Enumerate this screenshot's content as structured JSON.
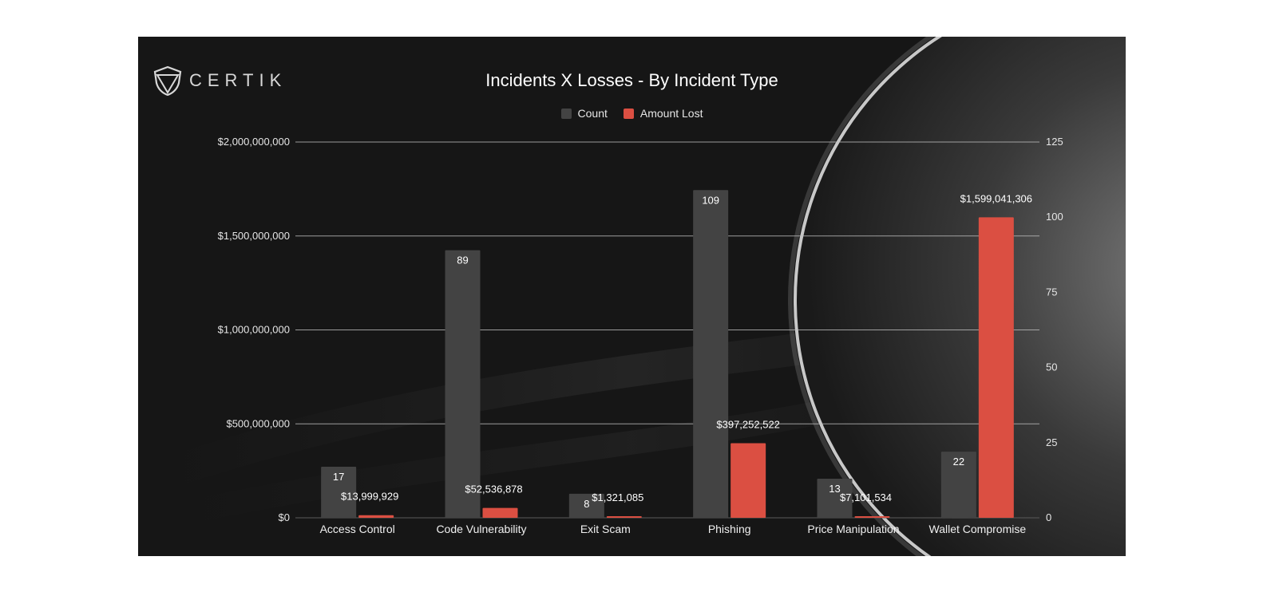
{
  "logo": {
    "text": "CERTIK"
  },
  "colors": {
    "count": "#434343",
    "amount_lost": "#db4f42",
    "background": "#161616"
  },
  "chart_data": {
    "type": "bar",
    "title": "Incidents X Losses - By Incident Type",
    "categories": [
      "Access Control",
      "Code Vulnerability",
      "Exit Scam",
      "Phishing",
      "Price Manipulation",
      "Wallet Compromise"
    ],
    "series": [
      {
        "name": "Count",
        "axis": "right",
        "values": [
          17,
          89,
          8,
          109,
          13,
          22
        ],
        "labels": [
          "17",
          "89",
          "8",
          "109",
          "13",
          "22"
        ]
      },
      {
        "name": "Amount Lost",
        "axis": "left",
        "values": [
          13999929,
          52536878,
          1321085,
          397252522,
          7101534,
          1599041306
        ],
        "labels": [
          "$13,999,929",
          "$52,536,878",
          "$1,321,085",
          "$397,252,522",
          "$7,101,534",
          "$1,599,041,306"
        ]
      }
    ],
    "left_axis": {
      "ylim": [
        0,
        2000000000
      ],
      "ticks": [
        "$0",
        "$500,000,000",
        "$1,000,000,000",
        "$1,500,000,000",
        "$2,000,000,000"
      ]
    },
    "right_axis": {
      "ylim": [
        0,
        125
      ],
      "ticks": [
        "0",
        "25",
        "50",
        "75",
        "100",
        "125"
      ]
    },
    "grid": true,
    "legend": "top-center"
  }
}
